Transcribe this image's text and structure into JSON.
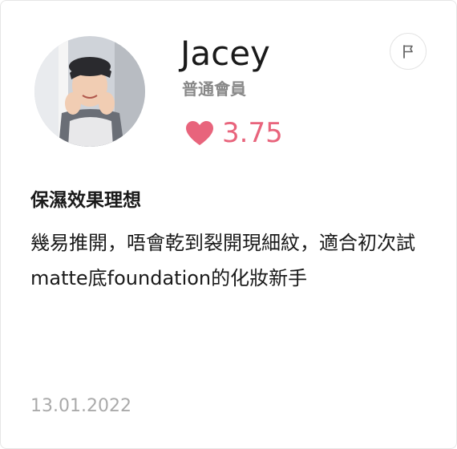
{
  "reviewer": {
    "name": "Jacey",
    "level": "普通會員",
    "avatar_icon": "user-photo"
  },
  "rating": {
    "value": "3.75",
    "icon": "heart-icon",
    "color": "#e8647c"
  },
  "report": {
    "icon": "flag-icon"
  },
  "review": {
    "title": "保濕效果理想",
    "body": "幾易推開，唔會乾到裂開現細紋，適合初次試matte底foundation的化妝新手",
    "date": "13.01.2022"
  }
}
